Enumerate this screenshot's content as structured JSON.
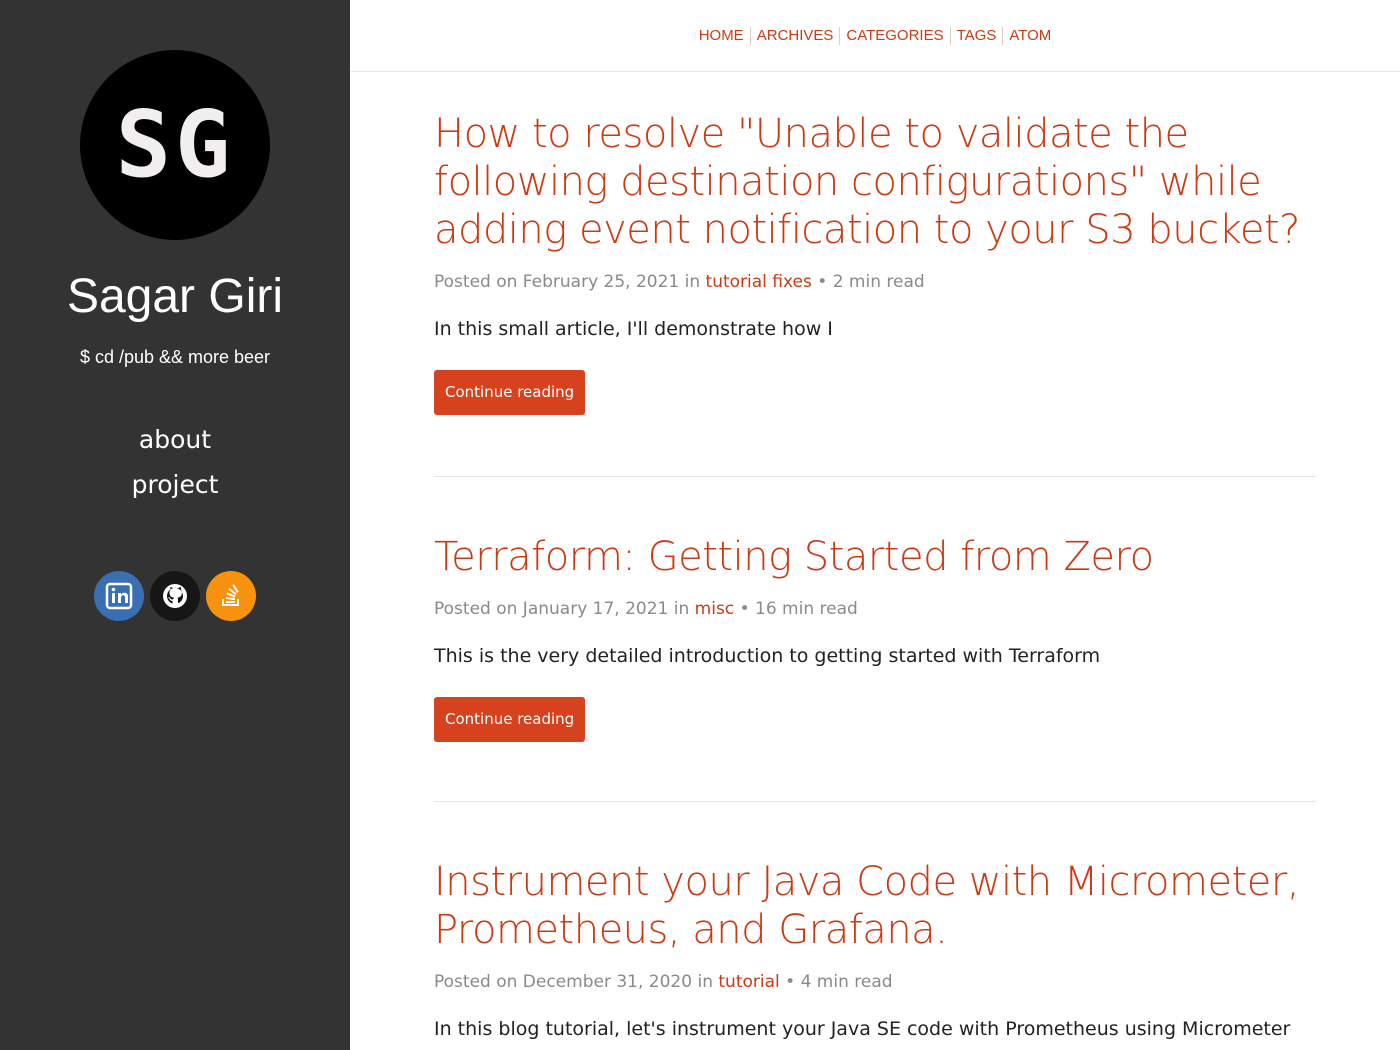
{
  "sidebar": {
    "logo_text": "SG",
    "title": "Sagar Giri",
    "tagline": "$ cd /pub && more beer",
    "nav": [
      {
        "label": "about"
      },
      {
        "label": "project"
      }
    ],
    "social": [
      {
        "icon": "linkedin-icon",
        "color": "#3a6fb5"
      },
      {
        "icon": "github-icon",
        "color": "#161616"
      },
      {
        "icon": "stackoverflow-icon",
        "color": "#f7920f"
      }
    ]
  },
  "topnav": {
    "home": "HOME",
    "archives": "ARCHIVES",
    "categories": "CATEGORIES",
    "tags": "TAGS",
    "atom": "ATOM"
  },
  "posts": [
    {
      "title": "How to resolve \"Unable to validate the following destination configurations\" while adding event notification to your S3 bucket?",
      "posted_prefix": "Posted on February 25, 2021 in",
      "category": "tutorial fixes",
      "read_time": "• 2 min read",
      "excerpt": "In this small article, I'll demonstrate how I",
      "cta": "Continue reading"
    },
    {
      "title": "Terraform: Getting Started from Zero",
      "posted_prefix": "Posted on January 17, 2021 in",
      "category": "misc",
      "read_time": "• 16 min read",
      "excerpt": "This is the very detailed introduction to getting started with Terraform",
      "cta": "Continue reading"
    },
    {
      "title": "Instrument your Java Code with Micrometer, Prometheus, and Grafana.",
      "posted_prefix": "Posted on December 31, 2020 in",
      "category": "tutorial",
      "read_time": "• 4 min read",
      "excerpt": "In this blog tutorial, let's instrument your Java SE code with Prometheus using Micrometer"
    }
  ],
  "colors": {
    "sidebar_bg": "#333333",
    "accent": "#cc3a14",
    "button_bg": "#d5421d"
  }
}
